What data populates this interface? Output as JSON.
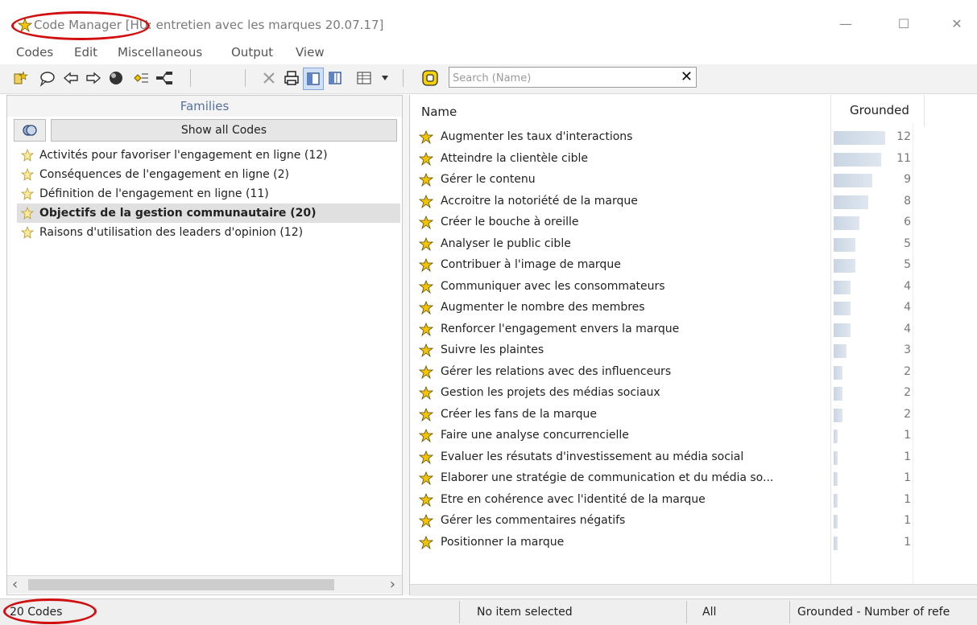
{
  "window": {
    "title_app": "Code Manager",
    "title_rest": " [HU: entretien avec les marques 20.07.17]",
    "controls": {
      "minimize": "—",
      "maximize": "☐",
      "close": "✕"
    }
  },
  "menu": [
    "Codes",
    "Edit",
    "Miscellaneous",
    "Output",
    "View"
  ],
  "toolbar": {
    "icons": [
      "new-code-icon",
      "comment-icon",
      "back-arrow-icon",
      "forward-arrow-icon",
      "circle-icon",
      "network-icon",
      "tree-icon",
      "delete-icon",
      "print-icon",
      "single-pane-icon",
      "split-pane-icon",
      "table-view-icon",
      "dropdown-icon"
    ]
  },
  "search": {
    "placeholder": "Search (Name)",
    "clear": "✕"
  },
  "families": {
    "header": "Families",
    "show_all_label": "Show all Codes",
    "items": [
      {
        "label": "Activités pour favoriser l'engagement en ligne (12)",
        "selected": false
      },
      {
        "label": "Conséquences de l'engagement en ligne (2)",
        "selected": false
      },
      {
        "label": "Définition de l'engagement en ligne (11)",
        "selected": false
      },
      {
        "label": "Objectifs de la gestion communautaire (20)",
        "selected": true
      },
      {
        "label": "Raisons d'utilisation des leaders d'opinion (12)",
        "selected": false
      }
    ]
  },
  "codes": {
    "col_name": "Name",
    "col_grounded": "Grounded",
    "max_grounded": 12,
    "rows": [
      {
        "name": "Augmenter les taux d'interactions",
        "grounded": 12
      },
      {
        "name": "Atteindre la clientèle cible",
        "grounded": 11
      },
      {
        "name": "Gérer le contenu",
        "grounded": 9
      },
      {
        "name": "Accroitre la notoriété de la marque",
        "grounded": 8
      },
      {
        "name": "Créer le bouche à oreille",
        "grounded": 6
      },
      {
        "name": "Analyser le public cible",
        "grounded": 5
      },
      {
        "name": "Contribuer à l'image de marque",
        "grounded": 5
      },
      {
        "name": "Communiquer avec les consommateurs",
        "grounded": 4
      },
      {
        "name": "Augmenter le nombre des membres",
        "grounded": 4
      },
      {
        "name": "Renforcer l'engagement envers la marque",
        "grounded": 4
      },
      {
        "name": "Suivre les plaintes",
        "grounded": 3
      },
      {
        "name": "Gérer les relations avec des influenceurs",
        "grounded": 2
      },
      {
        "name": "Gestion les projets des médias sociaux",
        "grounded": 2
      },
      {
        "name": "Créer les fans de la marque",
        "grounded": 2
      },
      {
        "name": "Faire une analyse concurrencielle",
        "grounded": 1
      },
      {
        "name": "Evaluer les résutats d'investissement au média social",
        "grounded": 1
      },
      {
        "name": "Elaborer une stratégie de communication et du média so...",
        "grounded": 1
      },
      {
        "name": "Etre en cohérence avec l'identité de la marque",
        "grounded": 1
      },
      {
        "name": "Gérer les commentaires négatifs",
        "grounded": 1
      },
      {
        "name": "Positionner la marque",
        "grounded": 1
      }
    ]
  },
  "status": {
    "count": "20 Codes",
    "selection": "No item selected",
    "filter": "All",
    "sort": "Grounded - Number of refe"
  },
  "colors": {
    "annotation": "#d10f0f",
    "accent": "#5470a0",
    "bar": "#c9d5e4"
  }
}
